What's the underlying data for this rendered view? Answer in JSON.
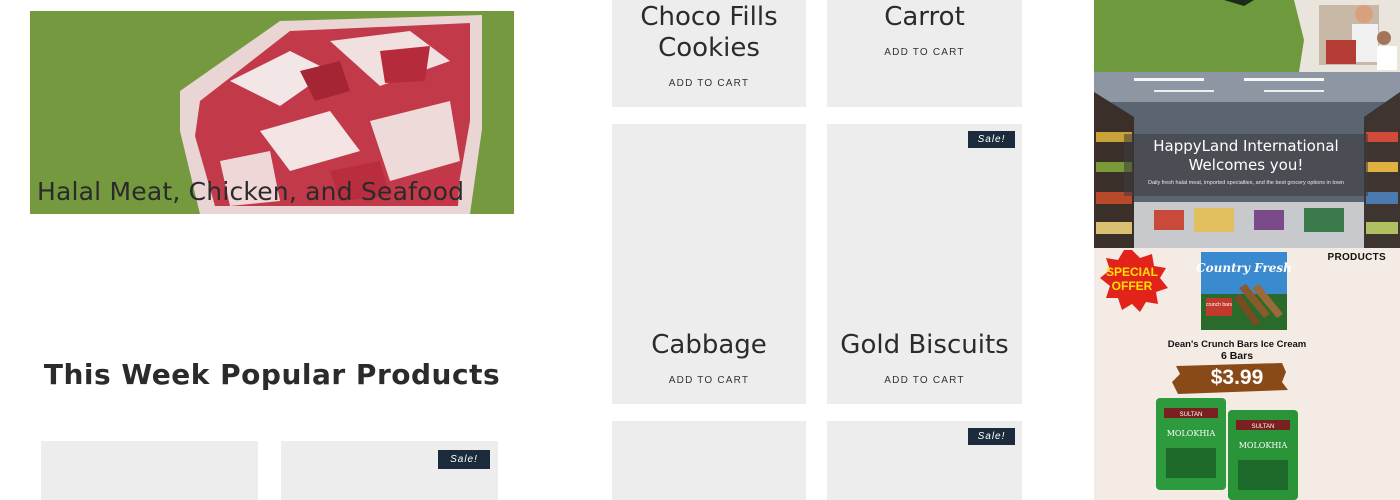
{
  "hero": {
    "title": "Halal Meat, Chicken, and Seafood"
  },
  "popular": {
    "title": "This Week Popular Products"
  },
  "products": [
    {
      "name": "Choco Fills Cookies",
      "button": "ADD TO CART"
    },
    {
      "name": "Carrot",
      "button": "ADD TO CART"
    },
    {
      "name": "Cabbage",
      "button": "ADD TO CART"
    },
    {
      "name": "Gold Biscuits",
      "button": "ADD TO CART",
      "sale": "Sale!"
    }
  ],
  "sale_badge": "Sale!",
  "store_banner": {
    "title": "HappyLand International Welcomes you!",
    "subtitle": "Daily fresh halal meat, imported specialties, and the best grocery options in town"
  },
  "offer": {
    "label": "PRODUCTS",
    "badge_line1": "SPECIAL",
    "badge_line2": "OFFER",
    "brand": "Country Fresh",
    "package_text": "crunch bars",
    "product_name": "Dean's Crunch Bars Ice Cream",
    "quantity": "6 Bars",
    "price": "$3.99",
    "bag_brand": "SULTAN",
    "bag_product": "MOLOKHIA"
  },
  "colors": {
    "hero_green": "#74993f",
    "card_bg": "#ededed",
    "sale_bg": "#1b2b3b",
    "offer_bg": "#f5ebe5",
    "price_banner": "#8a4a17"
  }
}
